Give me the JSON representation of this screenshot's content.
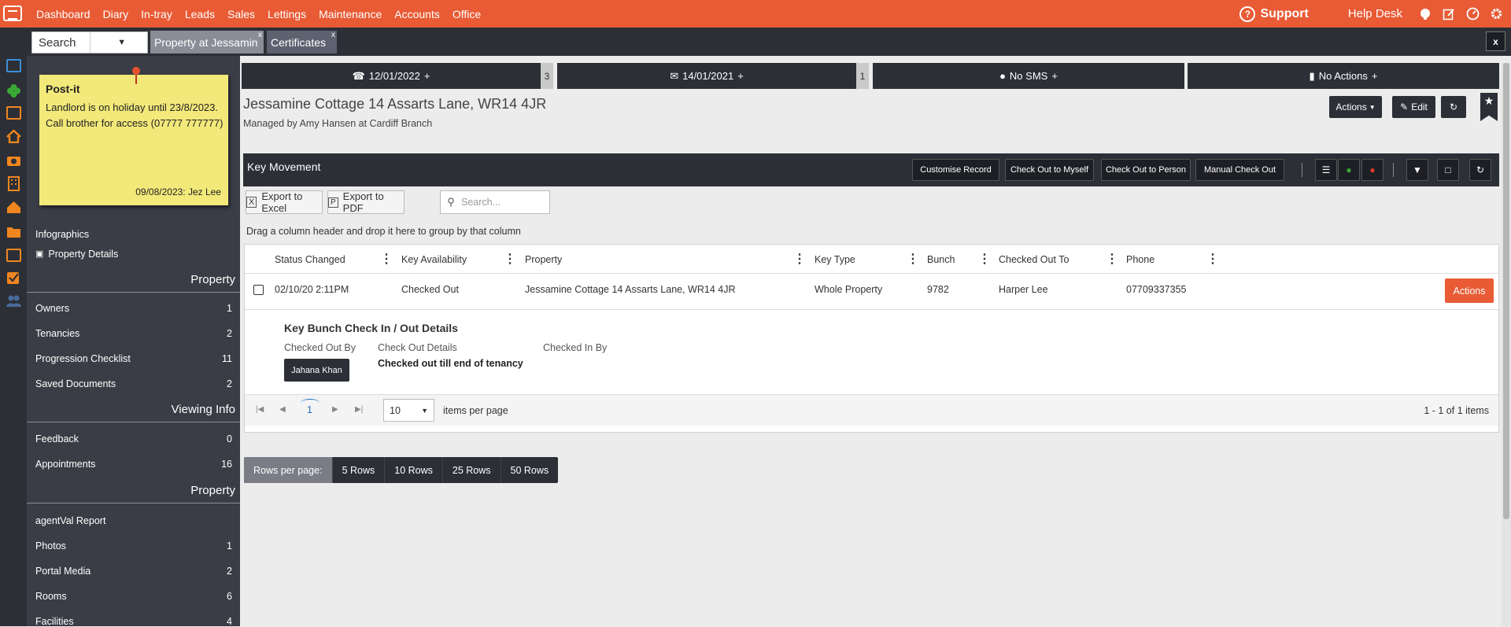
{
  "topnav": {
    "items": [
      "Dashboard",
      "Diary",
      "In-tray",
      "Leads",
      "Sales",
      "Lettings",
      "Maintenance",
      "Accounts",
      "Office"
    ],
    "support_label": "Support",
    "helpdesk_label": "Help Desk"
  },
  "tabbar": {
    "search_value": "Search",
    "tabs": [
      {
        "label": "Property at Jessamin",
        "close": "x"
      },
      {
        "label": "Certificates",
        "close": "x"
      }
    ],
    "close_all": "x"
  },
  "postit": {
    "title": "Post-it",
    "body": "Landlord is on holiday until 23/8/2023. Call brother for access (07777 777777)",
    "footer": "09/08/2023: Jez Lee"
  },
  "sidebar": {
    "infographics": "Infographics",
    "property_details": "Property Details",
    "sections": [
      {
        "heading": "Property",
        "items": [
          {
            "label": "Owners",
            "count": "1"
          },
          {
            "label": "Tenancies",
            "count": "2"
          },
          {
            "label": "Progression Checklist",
            "count": "11"
          },
          {
            "label": "Saved Documents",
            "count": "2"
          }
        ]
      },
      {
        "heading": "Viewing Info",
        "items": [
          {
            "label": "Feedback",
            "count": "0"
          },
          {
            "label": "Appointments",
            "count": "16"
          }
        ]
      },
      {
        "heading": "Property",
        "items": [
          {
            "label": "agentVal Report",
            "count": ""
          },
          {
            "label": "Photos",
            "count": "1"
          },
          {
            "label": "Portal Media",
            "count": "2"
          },
          {
            "label": "Rooms",
            "count": "6"
          },
          {
            "label": "Facilities",
            "count": "4"
          }
        ]
      }
    ]
  },
  "actionbar": [
    {
      "icon": "phone-icon",
      "label": "12/01/2022",
      "plus": "+",
      "badge": "3"
    },
    {
      "icon": "envelope-icon",
      "label": "14/01/2021",
      "plus": "+",
      "badge": "1"
    },
    {
      "icon": "sms-icon",
      "label": "No SMS",
      "plus": "+",
      "badge": ""
    },
    {
      "icon": "book-icon",
      "label": "No Actions",
      "plus": "+",
      "badge": ""
    }
  ],
  "property": {
    "title": "Jessamine Cottage 14 Assarts Lane, WR14 4JR",
    "subtitle": "Managed by Amy Hansen at Cardiff Branch",
    "actions_label": "Actions",
    "edit_label": "Edit"
  },
  "panel": {
    "title": "Key Movement",
    "buttons": [
      "Customise Record",
      "Check Out to Myself",
      "Check Out to Person",
      "Manual Check Out"
    ],
    "export_excel": "Export to Excel",
    "export_pdf": "Export to PDF",
    "search_placeholder": "Search...",
    "group_hint": "Drag a column header and drop it here to group by that column"
  },
  "grid": {
    "columns": [
      "Status Changed",
      "Key Availability",
      "Property",
      "Key Type",
      "Bunch",
      "Checked Out To",
      "Phone"
    ],
    "rows": [
      {
        "status_changed": "02/10/20 2:11PM",
        "availability": "Checked Out",
        "property": "Jessamine Cottage 14 Assarts Lane, WR14 4JR",
        "key_type": "Whole Property",
        "bunch": "9782",
        "checked_out_to": "Harper Lee",
        "phone": "07709337355",
        "action": "Actions"
      }
    ],
    "detail": {
      "title": "Key Bunch Check In / Out Details",
      "checked_out_by_label": "Checked Out By",
      "check_out_details_label": "Check Out Details",
      "checked_in_by_label": "Checked In By",
      "checked_out_by": "Jahana Khan",
      "check_out_details": "Checked out till end of tenancy"
    },
    "pager": {
      "page": "1",
      "page_size": "10",
      "items_label": "items per page",
      "summary": "1 - 1 of 1 items"
    }
  },
  "rows_per_page": {
    "label": "Rows per page:",
    "options": [
      "5 Rows",
      "10 Rows",
      "25 Rows",
      "50 Rows"
    ]
  },
  "colors": {
    "brand_orange": "#e85b35",
    "dark": "#2c2f36",
    "postit_yellow": "#f2e97a"
  }
}
